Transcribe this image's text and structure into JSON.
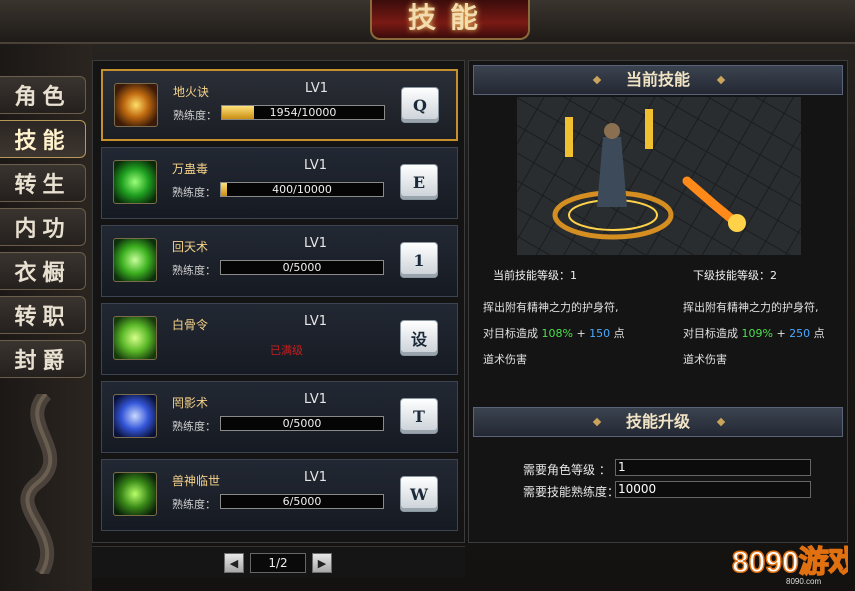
{
  "window": {
    "title": "技能"
  },
  "sidebar": {
    "tabs": [
      {
        "label": "角色"
      },
      {
        "label": "技能"
      },
      {
        "label": "转生"
      },
      {
        "label": "内功"
      },
      {
        "label": "衣橱"
      },
      {
        "label": "转职"
      },
      {
        "label": "封爵"
      }
    ],
    "active": "技能"
  },
  "skills": [
    {
      "name": "地火诀",
      "level": "LV1",
      "progress_label": "熟练度：",
      "progress_text": "1954/10000",
      "progress": 0.1954,
      "key": "Q",
      "selected": true
    },
    {
      "name": "万蛊毒",
      "level": "LV1",
      "progress_label": "熟练度：",
      "progress_text": "400/10000",
      "progress": 0.04,
      "key": "E",
      "selected": false
    },
    {
      "name": "回天术",
      "level": "LV1",
      "progress_label": "熟练度：",
      "progress_text": "0/5000",
      "progress": 0,
      "key": "1",
      "selected": false
    },
    {
      "name": "白骨令",
      "level": "LV1",
      "status": "已满级",
      "key": "设",
      "selected": false
    },
    {
      "name": "罔影术",
      "level": "LV1",
      "progress_label": "熟练度：",
      "progress_text": "0/5000",
      "progress": 0,
      "key": "T",
      "selected": false
    },
    {
      "name": "兽神临世",
      "level": "LV1",
      "progress_label": "熟练度：",
      "progress_text": "6/5000",
      "progress": 0.0012,
      "key": "W",
      "selected": false
    }
  ],
  "pager": {
    "prev": "◀",
    "page": "1/2",
    "next": "▶"
  },
  "current": {
    "header": "当前技能",
    "current_level_label": "当前技能等级：1",
    "next_level_label": "下级技能等级：2",
    "current_desc": {
      "line1": "挥出附有精神之力的护身符,",
      "line2_prefix": "对目标造成 ",
      "pct": "108%",
      "plus": " + ",
      "flat": "150",
      "line2_suffix": " 点",
      "line3": "道术伤害"
    },
    "next_desc": {
      "line1": "挥出附有精神之力的护身符,",
      "line2_prefix": "对目标造成 ",
      "pct": "109%",
      "plus": " + ",
      "flat": "250",
      "line2_suffix": " 点",
      "line3": "道术伤害"
    }
  },
  "upgrade": {
    "header": "技能升级",
    "req_level_label": "需要角色等级  ：",
    "req_level_value": "1",
    "req_prof_label": "需要技能熟练度：",
    "req_prof_value": "10000"
  },
  "watermark": {
    "text": "8090游戏",
    "site": "8090.com"
  },
  "colors": {
    "accent": "#c7902e",
    "green": "#4be04b",
    "blue": "#4aa8ff",
    "maxed": "#c81e1e"
  }
}
